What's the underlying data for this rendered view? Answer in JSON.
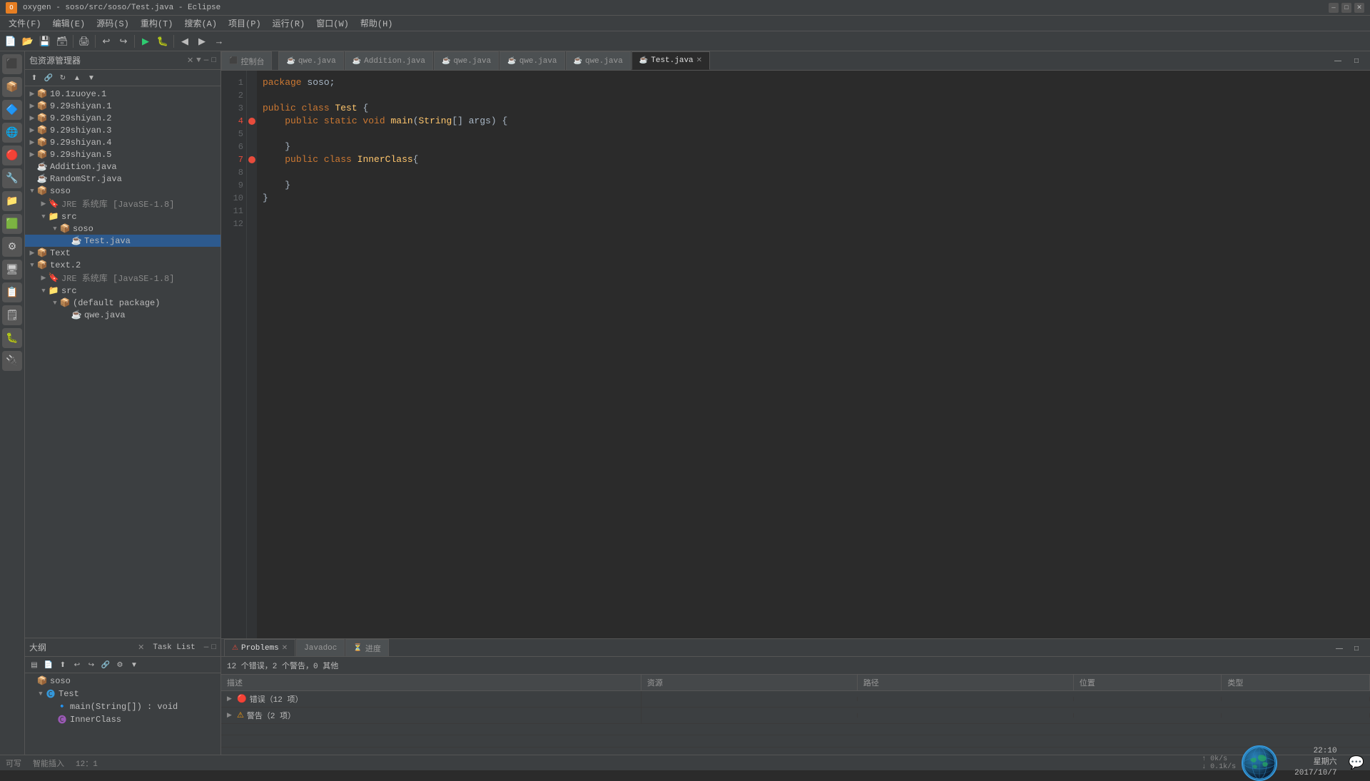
{
  "titlebar": {
    "icon": "O",
    "title": "oxygen - soso/src/soso/Test.java - Eclipse",
    "minimize": "—",
    "maximize": "□",
    "close": "✕"
  },
  "menubar": {
    "items": [
      "文件(F)",
      "编辑(E)",
      "源码(S)",
      "重构(T)",
      "搜索(A)",
      "项目(P)",
      "运行(R)",
      "窗口(W)",
      "帮助(H)"
    ]
  },
  "tabs": {
    "control": "控制台",
    "tabs": [
      {
        "label": "qwe.java",
        "active": false
      },
      {
        "label": "Addition.java",
        "active": false
      },
      {
        "label": "qwe.java",
        "active": false
      },
      {
        "label": "qwe.java",
        "active": false
      },
      {
        "label": "qwe.java",
        "active": false
      },
      {
        "label": "Test.java",
        "active": true
      }
    ]
  },
  "code": {
    "lines": [
      {
        "num": 1,
        "content": "package soso;"
      },
      {
        "num": 2,
        "content": ""
      },
      {
        "num": 3,
        "content": "public class Test {"
      },
      {
        "num": 4,
        "content": "    public static void main(String[] args) {",
        "bp": true
      },
      {
        "num": 5,
        "content": ""
      },
      {
        "num": 6,
        "content": "    }"
      },
      {
        "num": 7,
        "content": "    public class InnerClass{",
        "bp": true
      },
      {
        "num": 8,
        "content": ""
      },
      {
        "num": 9,
        "content": "    }"
      },
      {
        "num": 10,
        "content": ""
      },
      {
        "num": 11,
        "content": "}"
      },
      {
        "num": 12,
        "content": ""
      }
    ]
  },
  "package_explorer": {
    "title": "包资源管理器",
    "projects": [
      {
        "name": "10.1zuoye.1",
        "type": "project",
        "indent": 0,
        "expanded": false
      },
      {
        "name": "9.29shiyan.1",
        "type": "project",
        "indent": 0,
        "expanded": false
      },
      {
        "name": "9.29shiyan.2",
        "type": "project",
        "indent": 0,
        "expanded": false
      },
      {
        "name": "9.29shiyan.3",
        "type": "project",
        "indent": 0,
        "expanded": false
      },
      {
        "name": "9.29shiyan.4",
        "type": "project",
        "indent": 0,
        "expanded": false
      },
      {
        "name": "9.29shiyan.5",
        "type": "project",
        "indent": 0,
        "expanded": false
      },
      {
        "name": "Addition.java",
        "type": "java",
        "indent": 0,
        "expanded": false
      },
      {
        "name": "RandomStr.java",
        "type": "java",
        "indent": 0,
        "expanded": false
      },
      {
        "name": "soso",
        "type": "project",
        "indent": 0,
        "expanded": true
      },
      {
        "name": "JRE 系统库 [JavaSE-1.8]",
        "type": "jre",
        "indent": 1,
        "expanded": false
      },
      {
        "name": "src",
        "type": "folder",
        "indent": 1,
        "expanded": true
      },
      {
        "name": "soso",
        "type": "package",
        "indent": 2,
        "expanded": true
      },
      {
        "name": "Test.java",
        "type": "java",
        "indent": 3,
        "expanded": false,
        "selected": true
      },
      {
        "name": "Text",
        "type": "project",
        "indent": 0,
        "expanded": false
      },
      {
        "name": "text.2",
        "type": "project",
        "indent": 0,
        "expanded": true
      },
      {
        "name": "JRE 系统库 [JavaSE-1.8]",
        "type": "jre",
        "indent": 1,
        "expanded": false
      },
      {
        "name": "src",
        "type": "folder",
        "indent": 1,
        "expanded": true
      },
      {
        "name": "(default package)",
        "type": "package",
        "indent": 2,
        "expanded": true
      },
      {
        "name": "qwe.java",
        "type": "java",
        "indent": 3,
        "expanded": false
      }
    ]
  },
  "outline": {
    "title": "大纲",
    "items": [
      {
        "name": "soso",
        "type": "package",
        "indent": 0
      },
      {
        "name": "Test",
        "type": "class",
        "indent": 1,
        "expanded": true
      },
      {
        "name": "main(String[]) : void",
        "type": "method",
        "indent": 2
      },
      {
        "name": "InnerClass",
        "type": "inner",
        "indent": 2
      }
    ]
  },
  "task_list": {
    "title": "Task List"
  },
  "problems": {
    "title": "Problems",
    "summary": "12 个错误，2 个警告，0 其他",
    "tabs": [
      "Problems",
      "Javadoc",
      "进度"
    ],
    "columns": [
      "描述",
      "资源",
      "路径",
      "位置",
      "类型"
    ],
    "rows": [
      {
        "type": "error",
        "label": "错误（12 项）",
        "count": 12,
        "expanded": false
      },
      {
        "type": "warning",
        "label": "警告（2 项）",
        "count": 2,
        "expanded": false
      }
    ]
  },
  "statusbar": {
    "status": "可写",
    "mode": "智能插入",
    "position": "12：1"
  },
  "network": {
    "up": "0k/s",
    "down": "0.1k/s"
  },
  "clock": {
    "time": "22:10",
    "day": "星期六",
    "date": "2017/10/7"
  }
}
